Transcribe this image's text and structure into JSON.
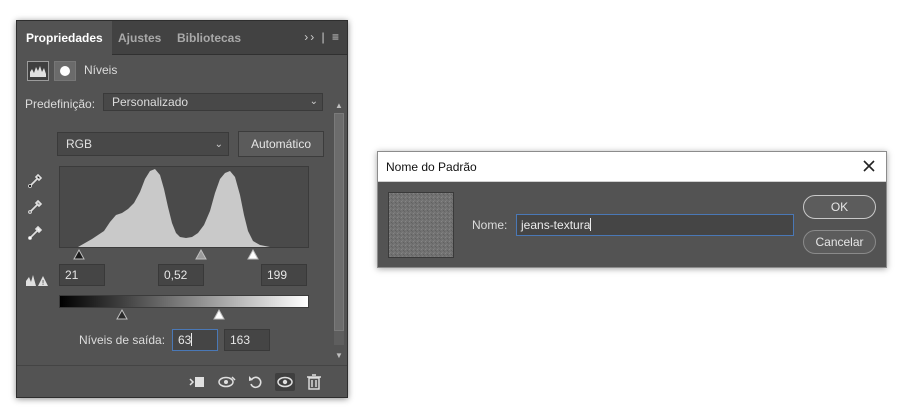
{
  "properties_panel": {
    "tabs": [
      {
        "label": "Propriedades",
        "active": true
      },
      {
        "label": "Ajustes",
        "active": false
      },
      {
        "label": "Bibliotecas",
        "active": false
      }
    ],
    "tab_menu_glyph": "›› | ≡",
    "layer_title": "Níveis",
    "preset_label": "Predefinição:",
    "preset_value": "Personalizado",
    "channel_value": "RGB",
    "auto_button": "Automático",
    "input_levels": {
      "black": "21",
      "gamma": "0,52",
      "white": "199"
    },
    "output_label": "Níveis de saída:",
    "output_levels": {
      "low": "63",
      "high": "163"
    },
    "bottom_icons": [
      "clip-to-layer-icon",
      "view-previous-state-icon",
      "reset-icon",
      "visibility-eye-icon",
      "trash-icon"
    ]
  },
  "dialog": {
    "title": "Nome do Padrão",
    "name_label": "Nome:",
    "name_value": "jeans-textura",
    "ok_label": "OK",
    "cancel_label": "Cancelar"
  },
  "colors": {
    "panel_bg": "#535353",
    "tab_bar_bg": "#424242",
    "histogram_fill": "#c9c9c9",
    "focus_blue": "#4a78b6"
  }
}
